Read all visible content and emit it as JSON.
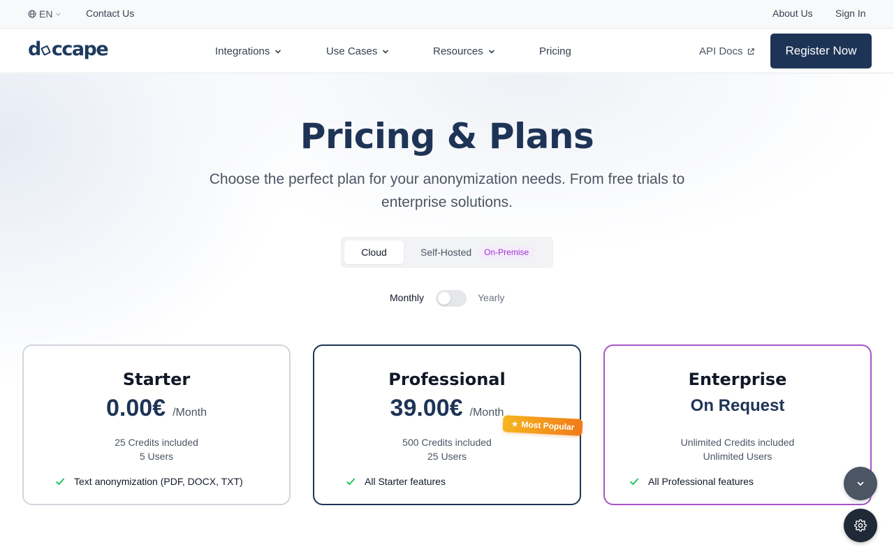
{
  "topbar": {
    "language": "EN",
    "contact": "Contact Us",
    "about": "About Us",
    "signin": "Sign In"
  },
  "nav": {
    "logo": "doccape",
    "items": [
      {
        "label": "Integrations",
        "has_dropdown": true
      },
      {
        "label": "Use Cases",
        "has_dropdown": true
      },
      {
        "label": "Resources",
        "has_dropdown": true
      },
      {
        "label": "Pricing",
        "has_dropdown": false
      }
    ],
    "api_docs": "API Docs",
    "register": "Register Now"
  },
  "hero": {
    "title": "Pricing & Plans",
    "subtitle": "Choose the perfect plan for your anonymization needs. From free trials to enterprise solutions."
  },
  "deployment": {
    "options": [
      "Cloud",
      "Self-Hosted"
    ],
    "selected": "Cloud",
    "self_hosted_badge": "On-Premise"
  },
  "billing": {
    "monthly": "Monthly",
    "yearly": "Yearly",
    "yearly_enabled": false
  },
  "plans": [
    {
      "name": "Starter",
      "price": "0.00€",
      "per": "/Month",
      "credits": "25 Credits included",
      "users": "5 Users",
      "first_feature": "Text anonymization (PDF, DOCX, TXT)"
    },
    {
      "name": "Professional",
      "price": "39.00€",
      "per": "/Month",
      "credits": "500 Credits included",
      "users": "25 Users",
      "first_feature": "All Starter features",
      "badge": "Most Popular"
    },
    {
      "name": "Enterprise",
      "price": "On Request",
      "credits": "Unlimited Credits included",
      "users": "Unlimited Users",
      "first_feature": "All Professional features"
    }
  ],
  "colors": {
    "brand_navy": "#1e3456",
    "accent_purple": "#a855c7",
    "badge_orange": "#f07a1a",
    "check_green": "#22c55e"
  },
  "icons": {
    "language": "globe-icon",
    "dropdown": "chevron-down-icon",
    "external": "external-link-icon",
    "feature": "check-icon",
    "popular": "star-icon",
    "scroll": "chevron-down-icon",
    "settings": "gear-icon"
  }
}
